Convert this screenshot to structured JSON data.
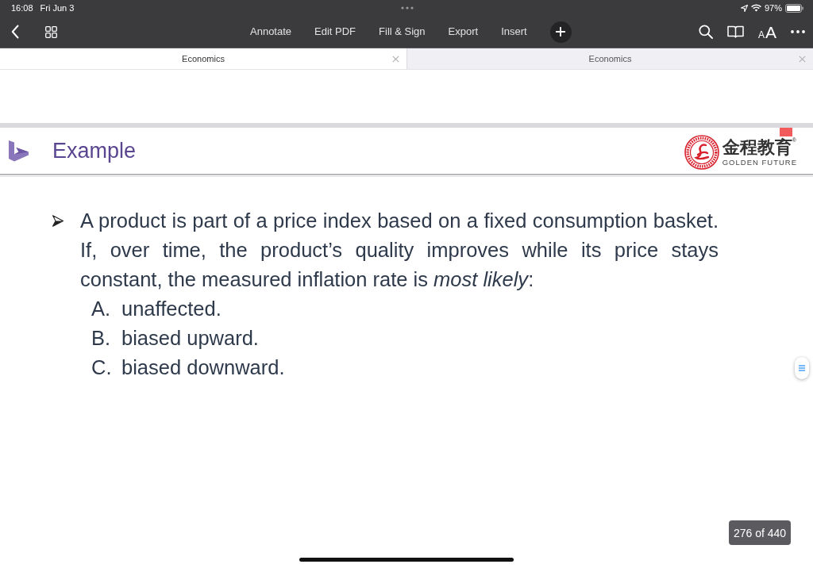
{
  "status_bar": {
    "time": "16:08",
    "date": "Fri Jun 3",
    "battery": "97%"
  },
  "toolbar": {
    "menu": [
      "Annotate",
      "Edit PDF",
      "Fill & Sign",
      "Export",
      "Insert"
    ],
    "text_size": {
      "small": "A",
      "large": "A"
    }
  },
  "tabs": [
    {
      "label": "Economics",
      "selected": true
    },
    {
      "label": "Economics",
      "selected": false
    }
  ],
  "slide": {
    "title": "Example",
    "logo": {
      "name": "金程教育$^{®}$",
      "tagline": "GOLDEN FUTURE"
    },
    "question": "A product is part of a price index based on a fixed consumption basket. If, over time, the product’s quality improves while its price stays constant, the measured inflation rate is *most likely*:",
    "options": [
      {
        "letter": "A.",
        "text": "unaffected."
      },
      {
        "letter": "B.",
        "text": "biased upward."
      },
      {
        "letter": "C.",
        "text": "biased downward."
      }
    ]
  },
  "page_indicator": "276 of 440"
}
